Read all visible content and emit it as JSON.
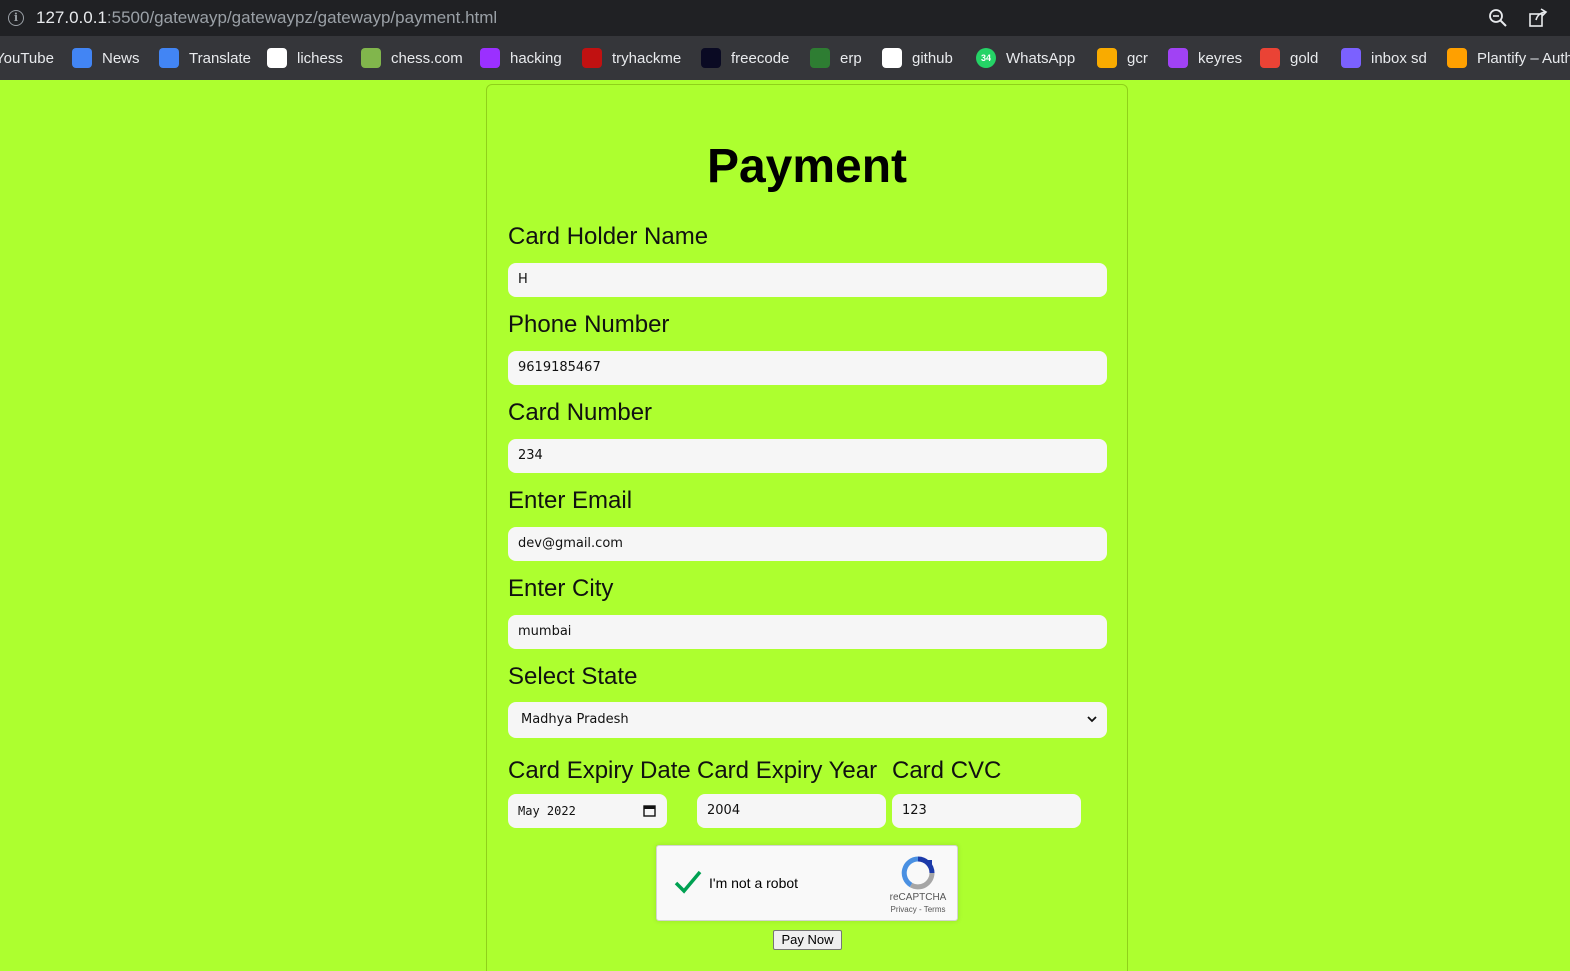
{
  "browser": {
    "url_host": "127.0.0.1",
    "url_path": ":5500/gatewayp/gatewaypz/gatewayp/payment.html",
    "bookmarks": [
      {
        "label": "YouTube",
        "icon": "youtube-icon",
        "color": "#ff0000"
      },
      {
        "label": "News",
        "icon": "news-icon",
        "color": "#4285f4"
      },
      {
        "label": "Translate",
        "icon": "translate-icon",
        "color": "#4285f4"
      },
      {
        "label": "lichess",
        "icon": "lichess-icon",
        "color": "#ffffff"
      },
      {
        "label": "chess.com",
        "icon": "chess-com-icon",
        "color": "#81b64c"
      },
      {
        "label": "hacking",
        "icon": "hacking-icon",
        "color": "#9b30ff"
      },
      {
        "label": "tryhackme",
        "icon": "tryhackme-icon",
        "color": "#c11111"
      },
      {
        "label": "freecode",
        "icon": "freecodecamp-icon",
        "color": "#0a0a23"
      },
      {
        "label": "erp",
        "icon": "erp-icon",
        "color": "#2e7d32"
      },
      {
        "label": "github",
        "icon": "github-icon",
        "color": "#ffffff"
      },
      {
        "label": "WhatsApp",
        "icon": "whatsapp-icon",
        "color": "#25d366",
        "badge": "34"
      },
      {
        "label": "gcr",
        "icon": "google-classroom-icon",
        "color": "#f9ab00"
      },
      {
        "label": "keyres",
        "icon": "keyres-icon",
        "color": "#a142f4"
      },
      {
        "label": "gold",
        "icon": "gmail-icon",
        "color": "#ea4335"
      },
      {
        "label": "inbox sd",
        "icon": "inbox-icon",
        "color": "#7b61ff"
      },
      {
        "label": "Plantify – Auth",
        "icon": "firebase-icon",
        "color": "#ffa000"
      }
    ]
  },
  "form": {
    "title": "Payment",
    "card_holder": {
      "label": "Card Holder Name",
      "value": "H"
    },
    "phone": {
      "label": "Phone Number",
      "value": "9619185467"
    },
    "card_number": {
      "label": "Card Number",
      "value": "234"
    },
    "email": {
      "label": "Enter Email",
      "value": "dev@gmail.com"
    },
    "city": {
      "label": "Enter City",
      "value": "mumbai"
    },
    "state": {
      "label": "Select State",
      "value": "Madhya Pradesh"
    },
    "expiry_date": {
      "label": "Card Expiry Date",
      "value": "May 2022"
    },
    "expiry_year": {
      "label": "Card Expiry Year",
      "value": "2004"
    },
    "cvc": {
      "label": "Card CVC",
      "value": "123"
    },
    "captcha": {
      "text": "I'm not a robot",
      "brand": "reCAPTCHA",
      "links": "Privacy - Terms"
    },
    "submit_label": "Pay Now"
  },
  "colors": {
    "page_background": "#adff2f",
    "check_green": "#00a152"
  }
}
